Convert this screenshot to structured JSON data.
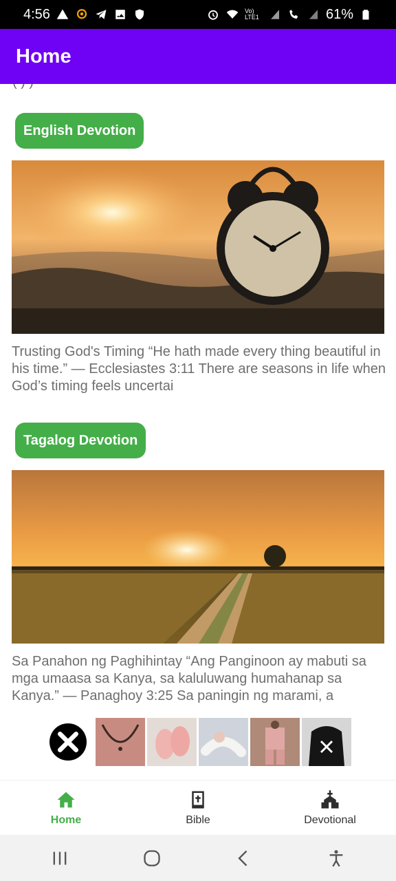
{
  "status_bar": {
    "time": "4:56",
    "battery": "61%",
    "network": "Vo) LTE1"
  },
  "app_bar": {
    "title": "Home"
  },
  "sections": [
    {
      "label": "English Devotion",
      "image": "sunrise-alarm-clock-photo",
      "excerpt": "Trusting God's Timing “He hath made every thing beautiful in his time.” — Ecclesiastes 3:11 There are seasons in life when God’s timing feels uncertai"
    },
    {
      "label": "Tagalog Devotion",
      "image": "sunset-field-road-photo",
      "excerpt": "Sa Panahon ng Paghihintay “Ang Panginoon ay mabuti sa mga umaasa sa Kanya, sa kaluluwang humahanap sa Kanya.” — Panaghoy 3:25 Sa paningin ng marami, a"
    }
  ],
  "ads": [
    "necklace",
    "pink-slippers",
    "body-pillow",
    "pink-pajamas",
    "black-hoodie"
  ],
  "bottom_nav": [
    {
      "label": "Home",
      "icon": "home-icon",
      "active": true
    },
    {
      "label": "Bible",
      "icon": "bible-icon",
      "active": false
    },
    {
      "label": "Devotional",
      "icon": "church-icon",
      "active": false
    }
  ],
  "colors": {
    "app_bar": "#6f02f4",
    "accent": "#44ae49"
  }
}
